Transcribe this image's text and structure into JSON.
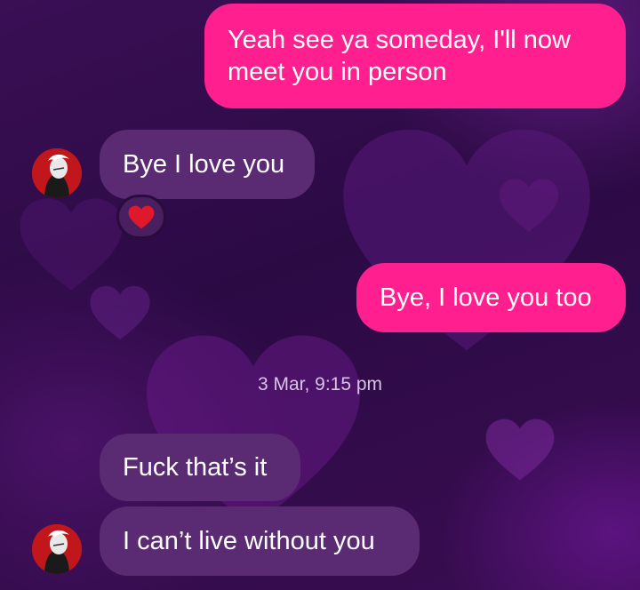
{
  "messages": [
    {
      "id": "m1",
      "direction": "outgoing",
      "lines": [
        "Yeah see ya someday, I'll now",
        "meet you in person"
      ]
    },
    {
      "id": "m2",
      "direction": "incoming",
      "text": "Bye I love you",
      "reaction_icon": "red-heart-icon"
    },
    {
      "id": "m3",
      "direction": "outgoing",
      "text": "Bye, I love you too"
    },
    {
      "id": "m4",
      "direction": "incoming",
      "text": "Fuck that’s it"
    },
    {
      "id": "m5",
      "direction": "incoming",
      "text": "I can’t live without you"
    }
  ],
  "timestamp": "3 Mar, 9:15 pm",
  "colors": {
    "outgoing_bubble": "#ff1f8e",
    "incoming_bubble": "#5a2a72",
    "background": "#2b0a44",
    "reaction_heart": "#e0182c",
    "avatar_bg": "#c0161c"
  },
  "icons": {
    "avatar": "avatar-icon",
    "reaction": "red-heart-icon"
  }
}
